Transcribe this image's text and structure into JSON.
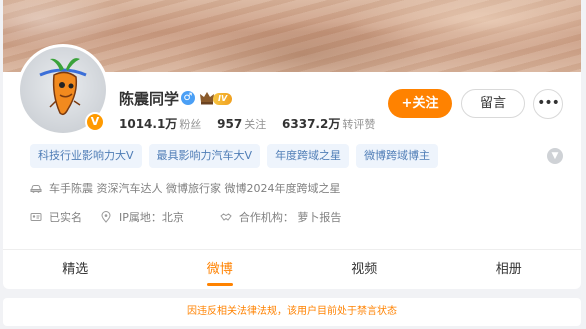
{
  "profile": {
    "name": "陈震同学",
    "gender_symbol": "♂",
    "level": "IV",
    "verified_mark": "V",
    "avatar_icon": "carrot-cartoon-icon"
  },
  "stats": {
    "followers_value": "1014.1万",
    "followers_label": "粉丝",
    "following_value": "957",
    "following_label": "关注",
    "reposts_value": "6337.2万",
    "reposts_label": "转评赞"
  },
  "actions": {
    "follow_label": "+关注",
    "message_label": "留言",
    "more_label": "•••"
  },
  "tags": [
    "科技行业影响力大V",
    "最具影响力汽车大V",
    "年度跨域之星",
    "微博跨域博主"
  ],
  "info": {
    "intro": "车手陈震 资深汽车达人 微博旅行家 微博2024年度跨域之星",
    "real_name": "已实名",
    "ip_location": "IP属地：北京",
    "organization": "合作机构： 萝卜报告"
  },
  "tabs": [
    {
      "label": "精选",
      "active": false
    },
    {
      "label": "微博",
      "active": true
    },
    {
      "label": "视频",
      "active": false
    },
    {
      "label": "相册",
      "active": false
    }
  ],
  "notice": "因违反相关法律法规，该用户目前处于禁言状态",
  "colors": {
    "accent": "#ff8200",
    "tag_text": "#4f7db6",
    "tag_bg": "#eef4fc"
  }
}
